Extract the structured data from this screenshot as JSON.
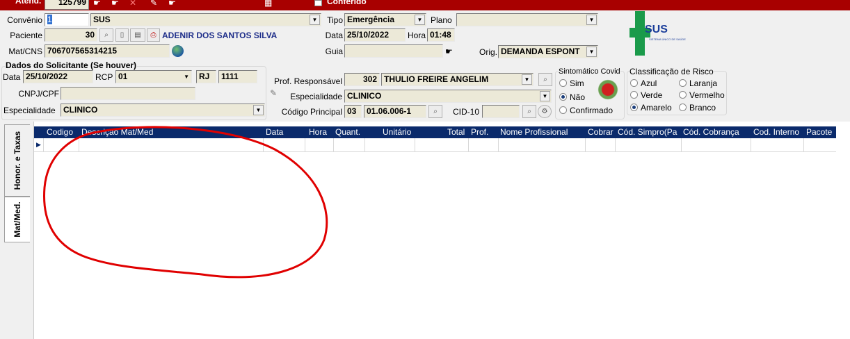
{
  "topbar": {
    "atend_label": "Atend.",
    "atend_value": "125799",
    "conferido_label": "Conferido"
  },
  "convenio": {
    "label": "Convênio",
    "code": "1",
    "name": "SUS"
  },
  "tipo": {
    "label": "Tipo",
    "value": "Emergência"
  },
  "plano": {
    "label": "Plano",
    "value": ""
  },
  "paciente": {
    "label": "Paciente",
    "code": "30",
    "name": "ADENIR DOS SANTOS SILVA"
  },
  "data": {
    "label": "Data",
    "value": "25/10/2022"
  },
  "hora": {
    "label": "Hora",
    "value": "01:48"
  },
  "matcns": {
    "label": "Mat/CNS",
    "value": "706707565314215"
  },
  "guia": {
    "label": "Guia",
    "value": ""
  },
  "origem": {
    "label": "Orig.",
    "value": "DEMANDA ESPONT"
  },
  "solicitante": {
    "title": "Dados do Solicitante (Se houver)",
    "data_label": "Data",
    "data_value": "25/10/2022",
    "rcp_label": "RCP",
    "rcp_value": "01",
    "uf": "RJ",
    "numero": "1111",
    "cnpj_label": "CNPJ/CPF",
    "cnpj_value": "",
    "especialidade_label": "Especialidade",
    "especialidade_value": "CLINICO"
  },
  "prof": {
    "label": "Prof. Responsável",
    "code": "302",
    "name": "THULIO FREIRE ANGELIM",
    "especialidade_label": "Especialidade",
    "especialidade_value": "CLINICO",
    "codigo_label": "Código Principal",
    "codigo_prefix": "03",
    "codigo_value": "01.06.006-1",
    "cid_label": "CID-10",
    "cid_value": ""
  },
  "covid": {
    "title": "Sintomático Covid",
    "options": [
      "Sim",
      "Não",
      "Confirmado"
    ],
    "selected": "Não"
  },
  "risco": {
    "title": "Classificação de Risco",
    "options": [
      "Azul",
      "Laranja",
      "Verde",
      "Vermelho",
      "Amarelo",
      "Branco"
    ],
    "selected": "Amarelo"
  },
  "logo": {
    "text": "SUS",
    "subtitle": "SISTEMA ÚNICO DE SAÚDE"
  },
  "tabs": [
    "Honor. e Taxas",
    "Mat/Med."
  ],
  "grid": {
    "columns": [
      "Codigo",
      "Descrição Mat/Med",
      "Data",
      "Hora",
      "Quant.",
      "Unitário",
      "Total",
      "Prof.",
      "Nome Profissional",
      "Cobrar",
      "Cód. Simpro(Pa",
      "Cód. Cobrança",
      "Cod. Interno",
      "Pacote"
    ]
  },
  "colors": {
    "header_bar": "#a80000",
    "grid_header": "#0a2a6b",
    "field_bg": "#ece9d8",
    "blue_text": "#1f2f8a",
    "annotation": "#e00000"
  }
}
